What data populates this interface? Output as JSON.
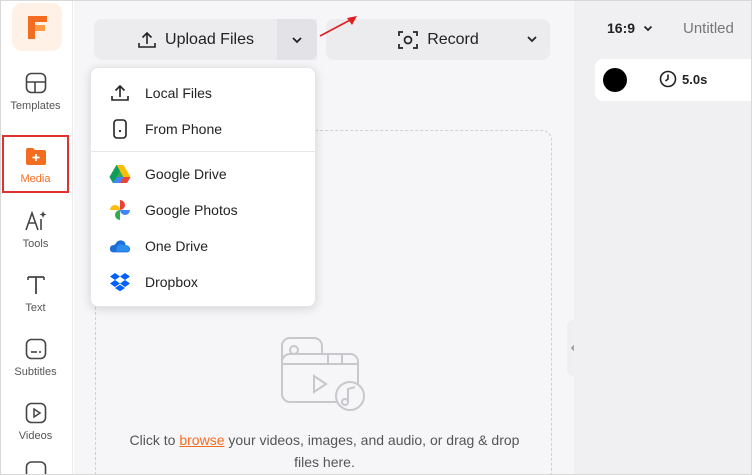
{
  "sidebar": {
    "logo_letter": "F",
    "items": [
      {
        "label": "Templates",
        "icon": "templates-icon"
      },
      {
        "label": "Media",
        "icon": "media-folder-icon",
        "active": true
      },
      {
        "label": "Tools",
        "icon": "ai-tools-icon"
      },
      {
        "label": "Text",
        "icon": "text-icon"
      },
      {
        "label": "Subtitles",
        "icon": "subtitles-icon"
      },
      {
        "label": "Videos",
        "icon": "videos-icon"
      }
    ]
  },
  "toolbar": {
    "upload_label": "Upload Files",
    "record_label": "Record"
  },
  "dropdown": {
    "items": [
      {
        "label": "Local Files",
        "icon": "upload-icon"
      },
      {
        "label": "From Phone",
        "icon": "phone-icon"
      },
      {
        "label": "Google Drive",
        "icon": "google-drive-icon"
      },
      {
        "label": "Google Photos",
        "icon": "google-photos-icon"
      },
      {
        "label": "One Drive",
        "icon": "onedrive-icon"
      },
      {
        "label": "Dropbox",
        "icon": "dropbox-icon"
      }
    ]
  },
  "dropzone": {
    "text_before": "Click to ",
    "link": "browse",
    "text_after": " your videos, images, and audio, or drag & drop files here."
  },
  "right_panel": {
    "aspect_ratio": "16:9",
    "project_title": "Untitled",
    "duration": "5.0s",
    "bg_color": "#000000"
  },
  "colors": {
    "accent": "#f36d21",
    "highlight_box": "#e03030",
    "annotation_arrow": "#e02020"
  }
}
